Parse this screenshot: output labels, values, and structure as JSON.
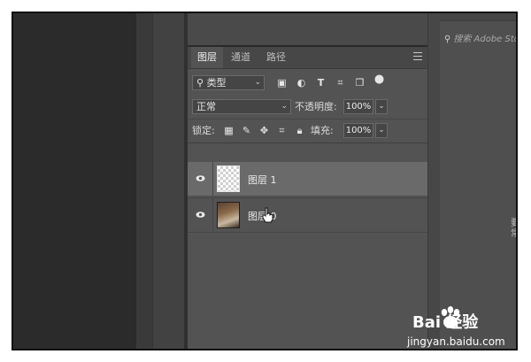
{
  "panel": {
    "tabs": [
      "图层",
      "通道",
      "路径"
    ],
    "active_tab": 0,
    "filter": {
      "label": "类型",
      "chevron": "⌄"
    },
    "filter_icons": [
      "image-filter-icon",
      "adjustment-filter-icon",
      "type-filter-icon",
      "shape-filter-icon",
      "smart-object-filter-icon",
      "toggle-filter-icon"
    ],
    "blend_mode": "正常",
    "opacity_label": "不透明度:",
    "opacity_value": "100%",
    "lock_label": "锁定:",
    "fill_label": "填充:",
    "fill_value": "100%",
    "layers": [
      {
        "name": "图层 1",
        "selected": true,
        "visible": true,
        "thumbnail": "transparent-checker"
      },
      {
        "name": "图层 0",
        "selected": false,
        "visible": true,
        "thumbnail": "photo"
      }
    ]
  },
  "right_panel": {
    "search_placeholder": "搜索 Adobe Stock",
    "hint_text": "要 常"
  },
  "watermark": {
    "brand": "Bai 经验",
    "url": "jingyan.baidu.com"
  },
  "colors": {
    "panel_bg": "#535353",
    "selected_layer": "#6a6a6a",
    "tab_bar": "#474747"
  }
}
